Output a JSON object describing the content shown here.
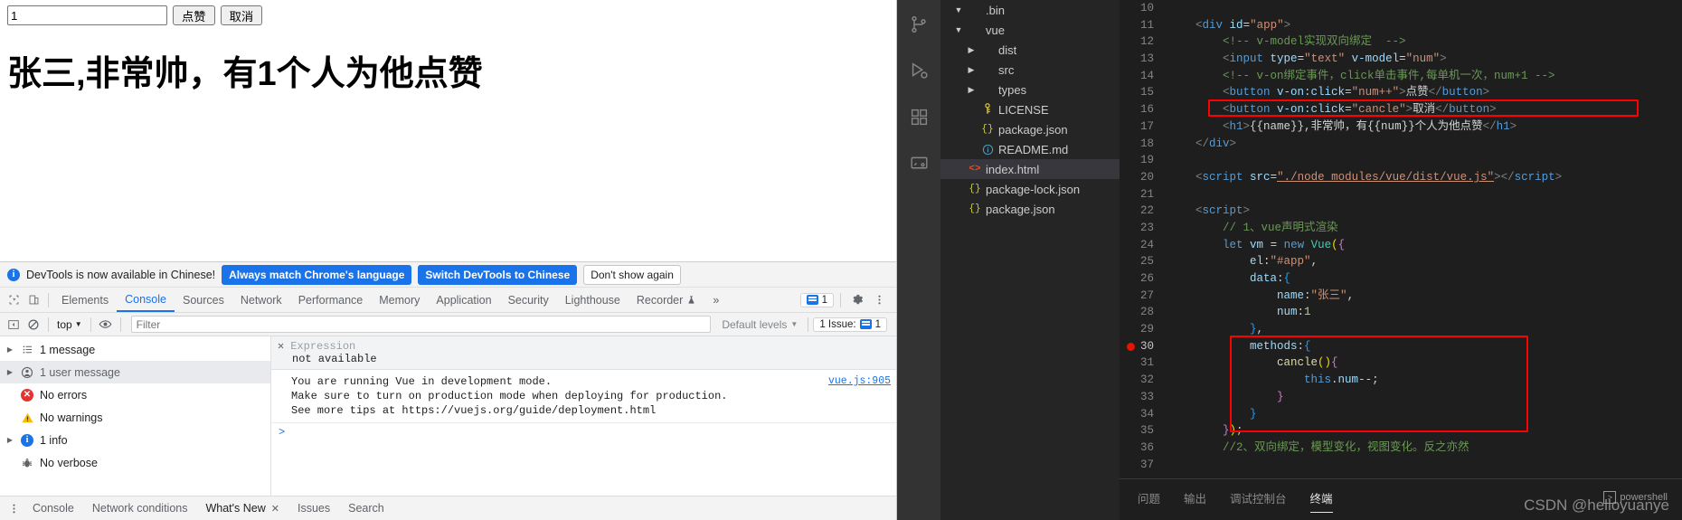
{
  "browser": {
    "input_value": "1",
    "input_placeholder": "",
    "like_button": "点赞",
    "cancel_button": "取消",
    "headline": "张三,非常帅，有1个人为他点赞"
  },
  "devtools": {
    "notice": {
      "icon": "info-icon",
      "text": "DevTools is now available in Chinese!",
      "always_match": "Always match Chrome's language",
      "switch_to_chinese": "Switch DevTools to Chinese",
      "dont_show": "Don't show again"
    },
    "tabs": [
      {
        "label": "Elements",
        "active": false
      },
      {
        "label": "Console",
        "active": true
      },
      {
        "label": "Sources",
        "active": false
      },
      {
        "label": "Network",
        "active": false
      },
      {
        "label": "Performance",
        "active": false
      },
      {
        "label": "Memory",
        "active": false
      },
      {
        "label": "Application",
        "active": false
      },
      {
        "label": "Security",
        "active": false
      },
      {
        "label": "Lighthouse",
        "active": false
      },
      {
        "label": "Recorder",
        "active": false
      }
    ],
    "overflow": "»",
    "issue_count": "1",
    "filterbar": {
      "context": "top",
      "filter_placeholder": "Filter",
      "levels": "Default levels",
      "issues_label": "1 Issue:",
      "issues_count": "1"
    },
    "sidebar": [
      {
        "label": "1 message",
        "icon": "list-icon",
        "expandable": true,
        "selected": false
      },
      {
        "label": "1 user message",
        "icon": "user-icon",
        "expandable": true,
        "selected": true
      },
      {
        "label": "No errors",
        "icon": "error-icon",
        "expandable": false,
        "selected": false
      },
      {
        "label": "No warnings",
        "icon": "warning-icon",
        "expandable": false,
        "selected": false
      },
      {
        "label": "1 info",
        "icon": "info-icon",
        "expandable": true,
        "selected": false
      },
      {
        "label": "No verbose",
        "icon": "bug-icon",
        "expandable": false,
        "selected": false
      }
    ],
    "console": {
      "expression_label": "Expression",
      "expression_value": "not available",
      "message_line1": "You are running Vue in development mode.",
      "message_line2": "Make sure to turn on production mode when deploying for production.",
      "message_line3_prefix": "See more tips at ",
      "message_link": "https://vuejs.org/guide/deployment.html",
      "source": "vue.js:905",
      "prompt": ">"
    },
    "drawer_tabs": [
      {
        "label": "Console",
        "closable": false,
        "active": false
      },
      {
        "label": "Network conditions",
        "closable": false,
        "active": false
      },
      {
        "label": "What's New",
        "closable": true,
        "active": true
      },
      {
        "label": "Issues",
        "closable": false,
        "active": false
      },
      {
        "label": "Search",
        "closable": false,
        "active": false
      }
    ]
  },
  "vscode": {
    "activity_items": [
      {
        "name": "source-control-icon"
      },
      {
        "name": "run-debug-icon"
      },
      {
        "name": "extensions-icon"
      },
      {
        "name": "remote-explorer-icon"
      }
    ],
    "explorer": [
      {
        "label": ".bin",
        "type": "folder",
        "expanded": true,
        "depth": 1,
        "selected": false
      },
      {
        "label": "vue",
        "type": "folder",
        "expanded": true,
        "depth": 1,
        "selected": false
      },
      {
        "label": "dist",
        "type": "folder",
        "expanded": false,
        "depth": 2,
        "selected": false
      },
      {
        "label": "src",
        "type": "folder",
        "expanded": false,
        "depth": 2,
        "selected": false
      },
      {
        "label": "types",
        "type": "folder",
        "expanded": false,
        "depth": 2,
        "selected": false
      },
      {
        "label": "LICENSE",
        "type": "license",
        "depth": 2,
        "selected": false
      },
      {
        "label": "package.json",
        "type": "json",
        "depth": 2,
        "selected": false
      },
      {
        "label": "README.md",
        "type": "md",
        "depth": 2,
        "selected": false
      },
      {
        "label": "index.html",
        "type": "html",
        "depth": 1,
        "selected": true
      },
      {
        "label": "package-lock.json",
        "type": "json",
        "depth": 1,
        "selected": false
      },
      {
        "label": "package.json",
        "type": "json",
        "depth": 1,
        "selected": false
      }
    ],
    "code_lines": [
      {
        "n": "10",
        "text": ""
      },
      {
        "n": "11",
        "text": "    <div id=\"app\">"
      },
      {
        "n": "12",
        "text": "        <!-- v-model实现双向绑定  -->"
      },
      {
        "n": "13",
        "text": "        <input type=\"text\" v-model=\"num\">"
      },
      {
        "n": "14",
        "text": "        <!-- v-on绑定事件，click单击事件,每单机一次，num+1 -->"
      },
      {
        "n": "15",
        "text": "        <button v-on:click=\"num++\">点赞</button>"
      },
      {
        "n": "16",
        "text": "        <button v-on:click=\"cancle\">取消</button>"
      },
      {
        "n": "17",
        "text": "        <h1>{{name}},非常帅，有{{num}}个人为他点赞</h1>"
      },
      {
        "n": "18",
        "text": "    </div>"
      },
      {
        "n": "19",
        "text": ""
      },
      {
        "n": "20",
        "text": "    <script src=\"./node_modules/vue/dist/vue.js\"></script>"
      },
      {
        "n": "21",
        "text": ""
      },
      {
        "n": "22",
        "text": "    <script>"
      },
      {
        "n": "23",
        "text": "        // 1、vue声明式渲染"
      },
      {
        "n": "24",
        "text": "        let vm = new Vue({"
      },
      {
        "n": "25",
        "text": "            el:\"#app\","
      },
      {
        "n": "26",
        "text": "            data:{"
      },
      {
        "n": "27",
        "text": "                name:\"张三\","
      },
      {
        "n": "28",
        "text": "                num:1"
      },
      {
        "n": "29",
        "text": "            },"
      },
      {
        "n": "30",
        "text": "            methods:{",
        "breakpoint": true
      },
      {
        "n": "31",
        "text": "                cancle(){"
      },
      {
        "n": "32",
        "text": "                    this.num--;"
      },
      {
        "n": "33",
        "text": "                }"
      },
      {
        "n": "34",
        "text": "            }"
      },
      {
        "n": "35",
        "text": "        });"
      },
      {
        "n": "36",
        "text": "        //2、双向绑定，模型变化，视图变化。反之亦然"
      },
      {
        "n": "37",
        "text": ""
      }
    ],
    "panel_tabs": [
      {
        "label": "问题",
        "active": false
      },
      {
        "label": "输出",
        "active": false
      },
      {
        "label": "调试控制台",
        "active": false
      },
      {
        "label": "终端",
        "active": true
      }
    ],
    "terminal_chip": "powershell",
    "watermark": "CSDN @helloyuanye",
    "annotation_color": "#ff0000"
  }
}
